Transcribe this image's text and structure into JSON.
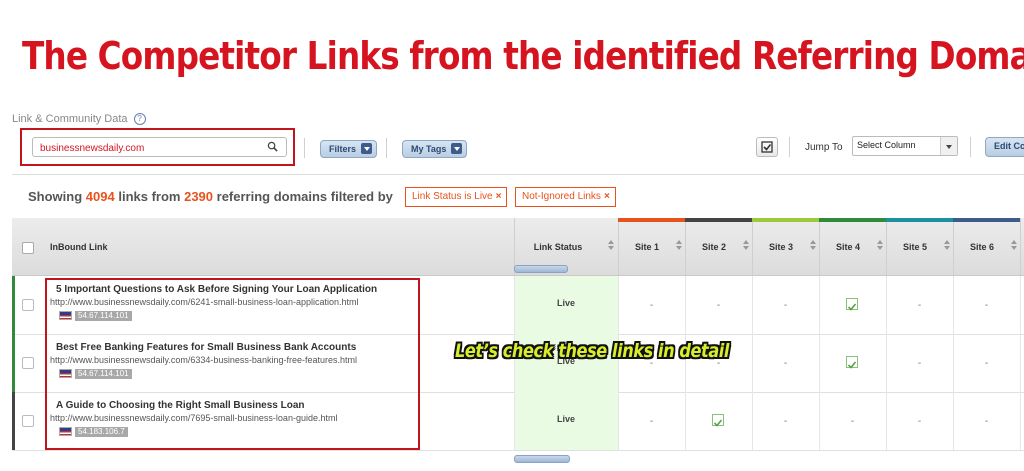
{
  "banner": {
    "title": "The Competitor Links from the identified Referring Domain"
  },
  "section": {
    "label": "Link & Community Data",
    "help_icon": "question-circle-icon"
  },
  "search": {
    "value": "businessnewsdaily.com",
    "icon": "search-icon"
  },
  "toolbar": {
    "filters_label": "Filters",
    "mytags_label": "My Tags",
    "jump_label": "Jump To",
    "jump_select_value": "Select Column",
    "edit_label": "Edit Columns"
  },
  "summary": {
    "prefix": "Showing",
    "links_count": "4094",
    "links_word": "links from",
    "domains_count": "2390",
    "suffix": "referring domains filtered by",
    "tags": [
      {
        "label": "Link Status is Live",
        "remove": "×"
      },
      {
        "label": "Not-Ignored Links",
        "remove": "×"
      }
    ]
  },
  "table": {
    "headers": {
      "inbound": "InBound Link",
      "status": "Link Status",
      "sites": [
        "Site 1",
        "Site 2",
        "Site 3",
        "Site 4",
        "Site 5",
        "Site 6"
      ]
    },
    "site_colors": [
      "#e8531d",
      "#444444",
      "#9dc93c",
      "#2f8a3a",
      "#1c8fa0",
      "#3d5c8a"
    ],
    "rows": [
      {
        "title": "5 Important Questions to Ask Before Signing Your Loan Application",
        "url": "http://www.businessnewsdaily.com/6241-small-business-loan-application.html",
        "ip": "54.67.114.101",
        "status": "Live",
        "accent": "#2f8a3a",
        "sites": [
          "-",
          "-",
          "-",
          "check",
          "-",
          "-"
        ]
      },
      {
        "title": "Best Free Banking Features for Small Business Bank Accounts",
        "url": "http://www.businessnewsdaily.com/6334-business-banking-free-features.html",
        "ip": "54.67.114.101",
        "status": "Live",
        "accent": "#2f8a3a",
        "sites": [
          "-",
          "-",
          "-",
          "check",
          "-",
          "-"
        ]
      },
      {
        "title": "A Guide to Choosing the Right Small Business Loan",
        "url": "http://www.businessnewsdaily.com/7695-small-business-loan-guide.html",
        "ip": "54.183.106.7",
        "status": "Live",
        "accent": "#444444",
        "sites": [
          "-",
          "check",
          "-",
          "-",
          "-",
          "-"
        ]
      }
    ]
  },
  "callout": {
    "text": "Let’s check these links in detail"
  }
}
